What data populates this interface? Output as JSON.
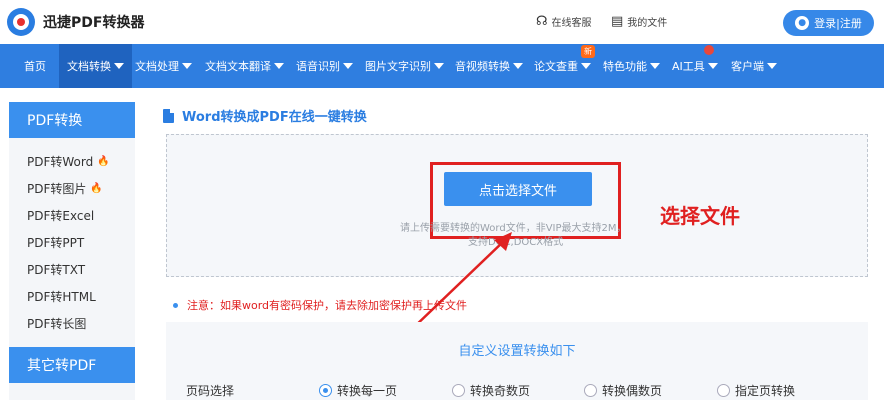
{
  "header": {
    "logo_text": "迅捷PDF转换器",
    "support_label": "在线客服",
    "myfiles_label": "我的文件",
    "login_label": "登录|注册"
  },
  "nav": {
    "items": [
      {
        "label": "首页",
        "caret": false
      },
      {
        "label": "文档转换",
        "caret": true
      },
      {
        "label": "文档处理",
        "caret": true
      },
      {
        "label": "文档文本翻译",
        "caret": true
      },
      {
        "label": "语音识别",
        "caret": true
      },
      {
        "label": "图片文字识别",
        "caret": true
      },
      {
        "label": "音视频转换",
        "caret": true
      },
      {
        "label": "论文查重",
        "caret": true
      },
      {
        "label": "特色功能",
        "caret": true
      },
      {
        "label": "AI工具",
        "caret": true
      },
      {
        "label": "客户端",
        "caret": true
      }
    ],
    "active_index": 1,
    "new_badge": "新"
  },
  "sidebar": {
    "section1_title": "PDF转换",
    "items": [
      {
        "label": "PDF转Word",
        "hot": true
      },
      {
        "label": "PDF转图片",
        "hot": true
      },
      {
        "label": "PDF转Excel",
        "hot": false
      },
      {
        "label": "PDF转PPT",
        "hot": false
      },
      {
        "label": "PDF转TXT",
        "hot": false
      },
      {
        "label": "PDF转HTML",
        "hot": false
      },
      {
        "label": "PDF转长图",
        "hot": false
      }
    ],
    "section2_title": "其它转PDF"
  },
  "main": {
    "title": "Word转换成PDF在线一键转换",
    "select_button": "点击选择文件",
    "hint_line1": "请上传需要转换的Word文件，非VIP最大支持2M，",
    "hint_line2": "支持DOC,DOCX格式",
    "annotation": "选择文件",
    "notice": "注意：如果word有密码保护，请去除加密保护再上传文件",
    "settings_title": "自定义设置转换如下",
    "page_select_label": "页码选择",
    "page_options": [
      "转换每一页",
      "转换奇数页",
      "转换偶数页",
      "指定页转换"
    ],
    "page_selected_index": 0
  },
  "colors": {
    "nav_bg": "#2f7ee0",
    "accent": "#3a90ee",
    "annotation_red": "#e02020"
  }
}
